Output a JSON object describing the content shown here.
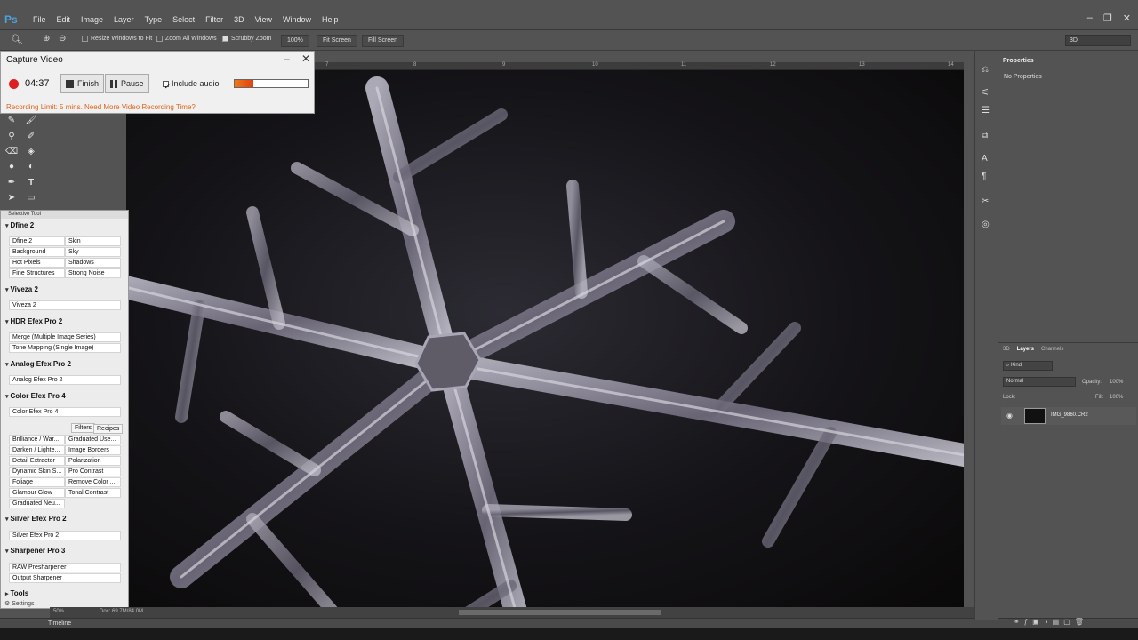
{
  "app": {
    "logo": "Ps"
  },
  "menu": [
    "File",
    "Edit",
    "Image",
    "Layer",
    "Type",
    "Select",
    "Filter",
    "3D",
    "View",
    "Window",
    "Help"
  ],
  "options": {
    "resize_windows": "Resize Windows to Fit",
    "zoom_all": "Zoom All Windows",
    "scrubby_zoom": "Scrubby Zoom",
    "scrubby_checked": true,
    "zoom_pct": "100%",
    "fit_screen": "Fit Screen",
    "fill_screen": "Fill Screen",
    "workspace": "3D"
  },
  "ruler": [
    "7",
    "8",
    "9",
    "10",
    "11",
    "12",
    "13",
    "14"
  ],
  "capture": {
    "title": "Capture Video",
    "time": "04:37",
    "finish": "Finish",
    "pause": "Pause",
    "include_audio": "Include audio",
    "include_audio_checked": true,
    "level": 0.25,
    "limit_text": "Recording Limit: 5 mins. Need More Video Recording Time?"
  },
  "selective": {
    "title": "Selective Tool",
    "dfine": {
      "title": "Dfine 2",
      "items": [
        "Dfine 2",
        "Skin",
        "Background",
        "Sky",
        "Hot Pixels",
        "Shadows",
        "Fine Structures",
        "Strong Noise"
      ]
    },
    "viveza": {
      "title": "Viveza 2",
      "items": [
        "Viveza 2"
      ]
    },
    "hdr": {
      "title": "HDR Efex Pro 2",
      "items": [
        "Merge (Multiple Image Series)",
        "Tone Mapping (Single Image)"
      ]
    },
    "analog": {
      "title": "Analog Efex Pro 2",
      "items": [
        "Analog Efex Pro 2"
      ]
    },
    "color": {
      "title": "Color Efex Pro 4",
      "items": [
        "Color Efex Pro 4"
      ],
      "tabs": [
        "Filters",
        "Recipes"
      ],
      "filters": [
        "Brilliance / War...",
        "Graduated Use...",
        "Darken / Lighte...",
        "Image Borders",
        "Detail Extractor",
        "Polarization",
        "Dynamic Skin S...",
        "Pro Contrast",
        "Foliage",
        "Remove Color ...",
        "Glamour Glow",
        "Tonal Contrast",
        "Graduated Neu..."
      ]
    },
    "silver": {
      "title": "Silver Efex Pro 2",
      "items": [
        "Silver Efex Pro 2"
      ]
    },
    "sharpener": {
      "title": "Sharpener Pro 3",
      "items": [
        "RAW Presharpener",
        "Output Sharpener"
      ]
    },
    "tools": "Tools",
    "settings": "Settings"
  },
  "status": {
    "zoom": "50%",
    "doc": "Doc: 69.7M/84.0M"
  },
  "timeline": "Timeline",
  "properties": {
    "tab": "Properties",
    "empty": "No Properties"
  },
  "layers": {
    "tabs": [
      "3D",
      "Layers",
      "Channels"
    ],
    "kind": "Kind",
    "blend": "Normal",
    "opacity_label": "Opacity:",
    "opacity": "100%",
    "lock_label": "Lock:",
    "fill_label": "Fill:",
    "fill": "100%",
    "layer_name": "IMG_9860.CR2"
  }
}
